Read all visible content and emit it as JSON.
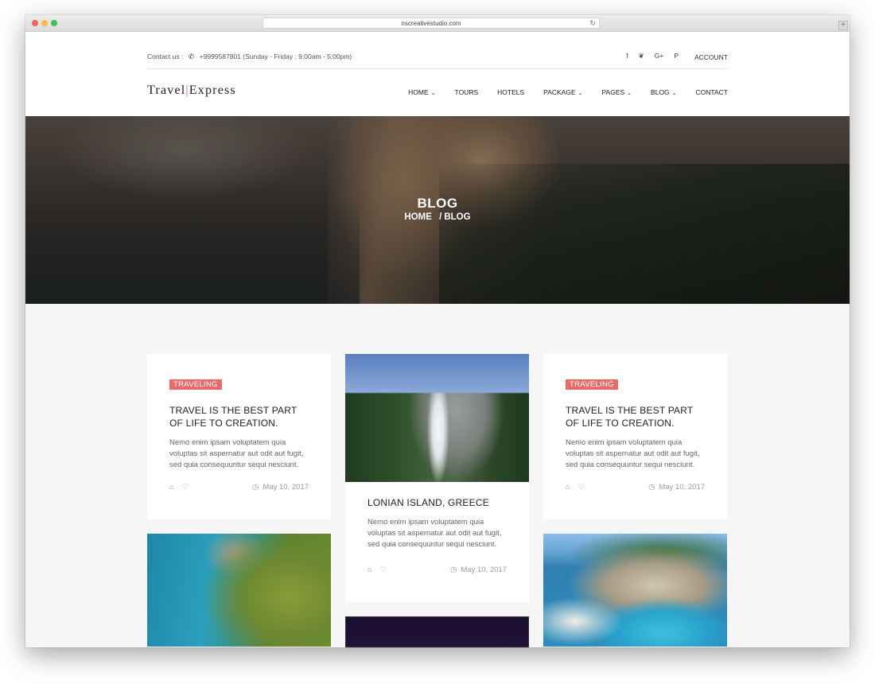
{
  "browser": {
    "url": "nscreativestudio.com"
  },
  "topbar": {
    "contact_label": "Contact us :",
    "phone": "+9999587801 (Sunday - Friday : 9:00am - 5:00pm)",
    "social_icons": [
      "facebook-icon",
      "twitter-icon",
      "google-plus-icon",
      "pinterest-icon"
    ],
    "social_glyphs": [
      "f",
      "❦",
      "G+",
      "P"
    ],
    "account_label": "ACCOUNT"
  },
  "brand": {
    "logo_part1": "Travel",
    "logo_bar": "|",
    "logo_part2": "Express",
    "accent_color": "#e96a6a"
  },
  "nav": {
    "items": [
      {
        "label": "HOME",
        "dropdown": true
      },
      {
        "label": "TOURS",
        "dropdown": false
      },
      {
        "label": "HOTELS",
        "dropdown": false
      },
      {
        "label": "PACKAGE",
        "dropdown": true
      },
      {
        "label": "PAGES",
        "dropdown": true
      },
      {
        "label": "BLOG",
        "dropdown": true
      },
      {
        "label": "CONTACT",
        "dropdown": false
      }
    ]
  },
  "hero": {
    "title": "BLOG",
    "breadcrumb_home": "HOME",
    "breadcrumb_sep": "/",
    "breadcrumb_current": "BLOG"
  },
  "cards": {
    "card1": {
      "tag": "TRAVELING",
      "title": "TRAVEL IS THE BEST PART OF LIFE TO CREATION.",
      "body": "Nemo enim ipsam voluptatem quia voluptas sit aspernatur aut odit aut fugit, sed quia consequuntur sequi nesciunt.",
      "date": "May 10, 2017"
    },
    "card2": {
      "title": "LONIAN ISLAND, GREECE",
      "body": "Nemo enim ipsam voluptatem quia voluptas sit aspernatur aut odit aut fugit, sed quia consequuntur sequi nesciunt.",
      "date": "May 10, 2017"
    },
    "card3": {
      "tag": "TRAVELING",
      "title": "TRAVEL IS THE BEST PART OF LIFE TO CREATION.",
      "body": "Nemo enim ipsam voluptatem quia voluptas sit aspernatur aut odit aut fugit, sed quia consequuntur sequi nesciunt.",
      "date": "May 10, 2017"
    }
  }
}
